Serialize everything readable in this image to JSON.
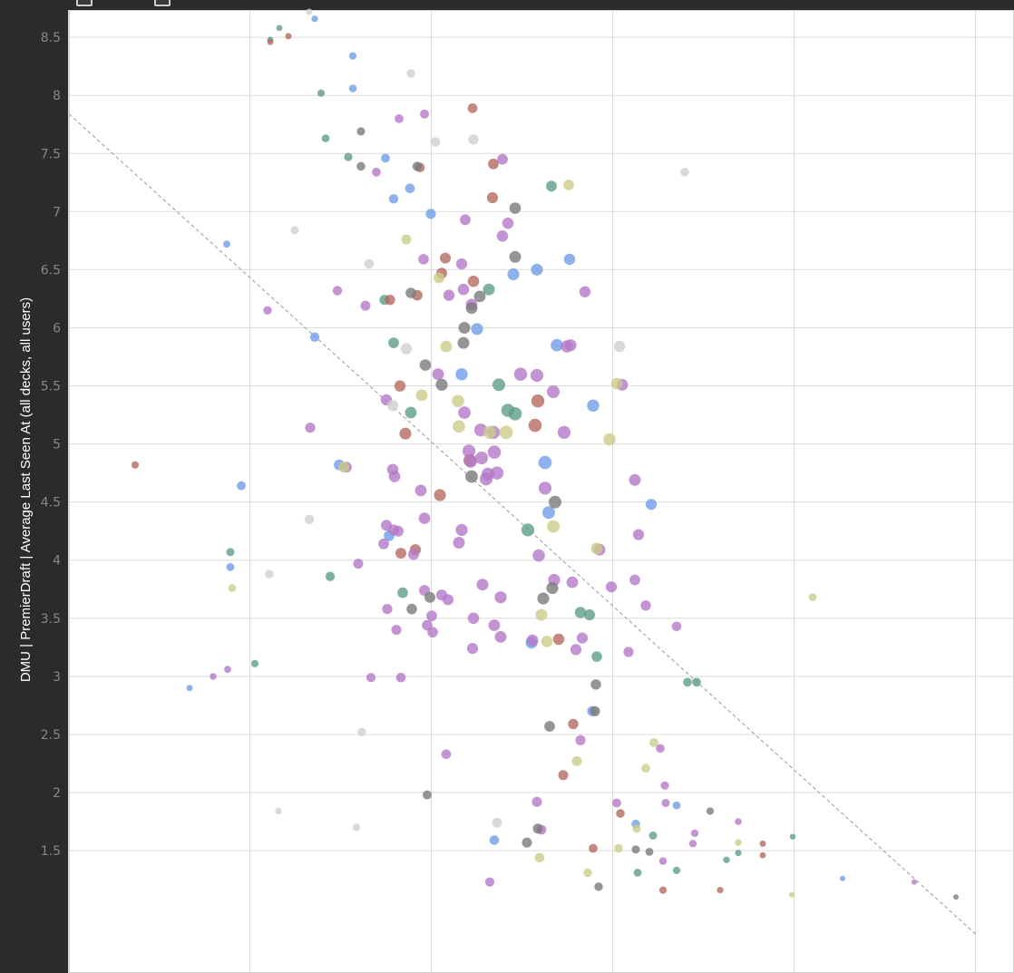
{
  "chart_data": {
    "type": "scatter",
    "title": "",
    "xlabel": "",
    "ylabel": "DMU | PremierDraft | Average Last Seen At (all decks, all users)",
    "yticks": [
      "8.5",
      "8",
      "7.5",
      "7",
      "6.5",
      "6",
      "5.5",
      "5",
      "4.5",
      "4",
      "3.5",
      "3",
      "2.5",
      "2",
      "1.5"
    ],
    "ylim": [
      0.75,
      8.75
    ],
    "xlim": [
      0,
      1
    ],
    "grid": true,
    "trendline": {
      "x": [
        0,
        1
      ],
      "y": [
        7.84,
        0.78
      ]
    },
    "series": [
      {
        "color": "#6f9de8",
        "points": [
          [
            0.271,
            8.66
          ],
          [
            0.313,
            8.34
          ],
          [
            0.313,
            8.06
          ],
          [
            0.349,
            7.46
          ],
          [
            0.376,
            7.2
          ],
          [
            0.358,
            7.11
          ],
          [
            0.399,
            6.98
          ],
          [
            0.174,
            6.72
          ],
          [
            0.49,
            6.46
          ],
          [
            0.516,
            6.5
          ],
          [
            0.552,
            6.59
          ],
          [
            0.271,
            5.92
          ],
          [
            0.538,
            5.85
          ],
          [
            0.433,
            5.6
          ],
          [
            0.298,
            4.82
          ],
          [
            0.19,
            4.64
          ],
          [
            0.178,
            3.94
          ],
          [
            0.353,
            4.21
          ],
          [
            0.525,
            4.84
          ],
          [
            0.529,
            4.41
          ],
          [
            0.578,
            5.33
          ],
          [
            0.642,
            4.48
          ],
          [
            0.51,
            3.29
          ],
          [
            0.133,
            2.9
          ],
          [
            0.577,
            2.7
          ],
          [
            0.625,
            1.73
          ],
          [
            0.469,
            1.59
          ],
          [
            0.67,
            1.89
          ],
          [
            0.853,
            1.26
          ],
          [
            0.45,
            5.99
          ]
        ]
      },
      {
        "color": "#5f9e8a",
        "points": [
          [
            0.222,
            8.48
          ],
          [
            0.232,
            8.58
          ],
          [
            0.278,
            8.02
          ],
          [
            0.283,
            7.63
          ],
          [
            0.308,
            7.47
          ],
          [
            0.532,
            7.22
          ],
          [
            0.358,
            5.87
          ],
          [
            0.377,
            5.27
          ],
          [
            0.463,
            6.33
          ],
          [
            0.474,
            5.51
          ],
          [
            0.484,
            5.29
          ],
          [
            0.492,
            5.26
          ],
          [
            0.506,
            4.26
          ],
          [
            0.178,
            4.07
          ],
          [
            0.288,
            3.86
          ],
          [
            0.368,
            3.72
          ],
          [
            0.564,
            3.55
          ],
          [
            0.574,
            3.53
          ],
          [
            0.582,
            3.17
          ],
          [
            0.682,
            2.95
          ],
          [
            0.692,
            2.95
          ],
          [
            0.205,
            3.11
          ],
          [
            0.644,
            1.63
          ],
          [
            0.627,
            1.31
          ],
          [
            0.67,
            1.33
          ],
          [
            0.725,
            1.42
          ],
          [
            0.738,
            1.48
          ],
          [
            0.798,
            1.62
          ],
          [
            0.348,
            6.24
          ]
        ]
      },
      {
        "color": "#b46a5f",
        "points": [
          [
            0.222,
            8.46
          ],
          [
            0.242,
            8.51
          ],
          [
            0.445,
            7.89
          ],
          [
            0.387,
            7.38
          ],
          [
            0.468,
            7.41
          ],
          [
            0.467,
            7.12
          ],
          [
            0.415,
            6.6
          ],
          [
            0.411,
            6.47
          ],
          [
            0.446,
            6.4
          ],
          [
            0.354,
            6.24
          ],
          [
            0.384,
            6.28
          ],
          [
            0.365,
            5.5
          ],
          [
            0.371,
            5.09
          ],
          [
            0.517,
            5.37
          ],
          [
            0.514,
            5.16
          ],
          [
            0.073,
            4.82
          ],
          [
            0.409,
            4.56
          ],
          [
            0.366,
            4.06
          ],
          [
            0.382,
            4.09
          ],
          [
            0.442,
            4.86
          ],
          [
            0.54,
            3.32
          ],
          [
            0.556,
            2.59
          ],
          [
            0.545,
            2.15
          ],
          [
            0.578,
            1.52
          ],
          [
            0.608,
            1.82
          ],
          [
            0.655,
            1.16
          ],
          [
            0.718,
            1.16
          ],
          [
            0.765,
            1.56
          ],
          [
            0.765,
            1.46
          ]
        ]
      },
      {
        "color": "#b478c8",
        "points": [
          [
            0.364,
            7.8
          ],
          [
            0.392,
            7.84
          ],
          [
            0.339,
            7.34
          ],
          [
            0.478,
            7.45
          ],
          [
            0.437,
            6.93
          ],
          [
            0.484,
            6.9
          ],
          [
            0.478,
            6.79
          ],
          [
            0.391,
            6.59
          ],
          [
            0.433,
            6.55
          ],
          [
            0.569,
            6.31
          ],
          [
            0.296,
            6.32
          ],
          [
            0.327,
            6.19
          ],
          [
            0.219,
            6.15
          ],
          [
            0.419,
            6.28
          ],
          [
            0.435,
            6.33
          ],
          [
            0.444,
            6.2
          ],
          [
            0.549,
            5.84
          ],
          [
            0.553,
            5.85
          ],
          [
            0.407,
            5.6
          ],
          [
            0.498,
            5.6
          ],
          [
            0.516,
            5.59
          ],
          [
            0.534,
            5.45
          ],
          [
            0.61,
            5.51
          ],
          [
            0.35,
            5.38
          ],
          [
            0.436,
            5.27
          ],
          [
            0.454,
            5.12
          ],
          [
            0.468,
            5.1
          ],
          [
            0.546,
            5.1
          ],
          [
            0.266,
            5.14
          ],
          [
            0.441,
            4.94
          ],
          [
            0.443,
            4.85
          ],
          [
            0.455,
            4.88
          ],
          [
            0.469,
            4.93
          ],
          [
            0.472,
            4.75
          ],
          [
            0.46,
            4.7
          ],
          [
            0.462,
            4.74
          ],
          [
            0.525,
            4.62
          ],
          [
            0.624,
            4.69
          ],
          [
            0.388,
            4.6
          ],
          [
            0.306,
            4.8
          ],
          [
            0.357,
            4.78
          ],
          [
            0.359,
            4.72
          ],
          [
            0.392,
            4.36
          ],
          [
            0.35,
            4.3
          ],
          [
            0.358,
            4.26
          ],
          [
            0.363,
            4.25
          ],
          [
            0.433,
            4.26
          ],
          [
            0.347,
            4.14
          ],
          [
            0.43,
            4.15
          ],
          [
            0.585,
            4.09
          ],
          [
            0.628,
            4.22
          ],
          [
            0.319,
            3.97
          ],
          [
            0.518,
            4.04
          ],
          [
            0.535,
            3.83
          ],
          [
            0.555,
            3.81
          ],
          [
            0.598,
            3.77
          ],
          [
            0.624,
            3.83
          ],
          [
            0.636,
            3.61
          ],
          [
            0.392,
            3.74
          ],
          [
            0.456,
            3.79
          ],
          [
            0.476,
            3.68
          ],
          [
            0.411,
            3.7
          ],
          [
            0.418,
            3.66
          ],
          [
            0.4,
            3.52
          ],
          [
            0.446,
            3.5
          ],
          [
            0.469,
            3.44
          ],
          [
            0.476,
            3.34
          ],
          [
            0.511,
            3.31
          ],
          [
            0.351,
            3.58
          ],
          [
            0.361,
            3.4
          ],
          [
            0.395,
            3.44
          ],
          [
            0.401,
            3.38
          ],
          [
            0.559,
            3.23
          ],
          [
            0.617,
            3.21
          ],
          [
            0.67,
            3.43
          ],
          [
            0.333,
            2.99
          ],
          [
            0.366,
            2.99
          ],
          [
            0.159,
            3.0
          ],
          [
            0.175,
            3.06
          ],
          [
            0.445,
            3.24
          ],
          [
            0.416,
            2.33
          ],
          [
            0.564,
            2.45
          ],
          [
            0.652,
            2.38
          ],
          [
            0.657,
            2.06
          ],
          [
            0.604,
            1.91
          ],
          [
            0.658,
            1.91
          ],
          [
            0.69,
            1.65
          ],
          [
            0.688,
            1.56
          ],
          [
            0.738,
            1.75
          ],
          [
            0.516,
            1.92
          ],
          [
            0.521,
            1.68
          ],
          [
            0.464,
            1.23
          ],
          [
            0.655,
            1.41
          ],
          [
            0.932,
            1.23
          ],
          [
            0.566,
            3.33
          ],
          [
            0.38,
            4.05
          ]
        ]
      },
      {
        "color": "#7a7a7a",
        "points": [
          [
            0.322,
            7.69
          ],
          [
            0.322,
            7.39
          ],
          [
            0.384,
            7.39
          ],
          [
            0.492,
            7.03
          ],
          [
            0.492,
            6.61
          ],
          [
            0.377,
            6.3
          ],
          [
            0.444,
            6.17
          ],
          [
            0.453,
            6.27
          ],
          [
            0.436,
            6.0
          ],
          [
            0.435,
            5.87
          ],
          [
            0.393,
            5.68
          ],
          [
            0.411,
            5.51
          ],
          [
            0.444,
            4.72
          ],
          [
            0.536,
            4.5
          ],
          [
            0.378,
            3.58
          ],
          [
            0.398,
            3.68
          ],
          [
            0.523,
            3.67
          ],
          [
            0.533,
            3.76
          ],
          [
            0.581,
            2.93
          ],
          [
            0.58,
            2.7
          ],
          [
            0.53,
            2.57
          ],
          [
            0.395,
            1.98
          ],
          [
            0.517,
            1.69
          ],
          [
            0.505,
            1.57
          ],
          [
            0.625,
            1.51
          ],
          [
            0.64,
            1.49
          ],
          [
            0.707,
            1.84
          ],
          [
            0.584,
            1.19
          ],
          [
            0.978,
            1.1
          ]
        ]
      },
      {
        "color": "#cccc88",
        "points": [
          [
            0.551,
            7.23
          ],
          [
            0.372,
            6.76
          ],
          [
            0.408,
            6.43
          ],
          [
            0.416,
            5.84
          ],
          [
            0.389,
            5.42
          ],
          [
            0.429,
            5.37
          ],
          [
            0.43,
            5.15
          ],
          [
            0.464,
            5.1
          ],
          [
            0.482,
            5.1
          ],
          [
            0.604,
            5.52
          ],
          [
            0.596,
            5.04
          ],
          [
            0.303,
            4.8
          ],
          [
            0.534,
            4.29
          ],
          [
            0.582,
            4.1
          ],
          [
            0.18,
            3.76
          ],
          [
            0.521,
            3.53
          ],
          [
            0.527,
            3.3
          ],
          [
            0.82,
            3.68
          ],
          [
            0.645,
            2.43
          ],
          [
            0.636,
            2.21
          ],
          [
            0.56,
            2.27
          ],
          [
            0.626,
            1.69
          ],
          [
            0.519,
            1.44
          ],
          [
            0.572,
            1.31
          ],
          [
            0.606,
            1.52
          ],
          [
            0.738,
            1.57
          ],
          [
            0.797,
            1.12
          ]
        ]
      },
      {
        "color": "#cfcfcf",
        "points": [
          [
            0.265,
            8.72
          ],
          [
            0.377,
            8.19
          ],
          [
            0.404,
            7.6
          ],
          [
            0.446,
            7.62
          ],
          [
            0.679,
            7.34
          ],
          [
            0.249,
            6.84
          ],
          [
            0.331,
            6.55
          ],
          [
            0.372,
            5.82
          ],
          [
            0.607,
            5.84
          ],
          [
            0.357,
            5.33
          ],
          [
            0.265,
            4.35
          ],
          [
            0.221,
            3.88
          ],
          [
            0.323,
            2.52
          ],
          [
            0.231,
            1.84
          ],
          [
            0.317,
            1.7
          ],
          [
            0.472,
            1.74
          ]
        ]
      }
    ]
  }
}
